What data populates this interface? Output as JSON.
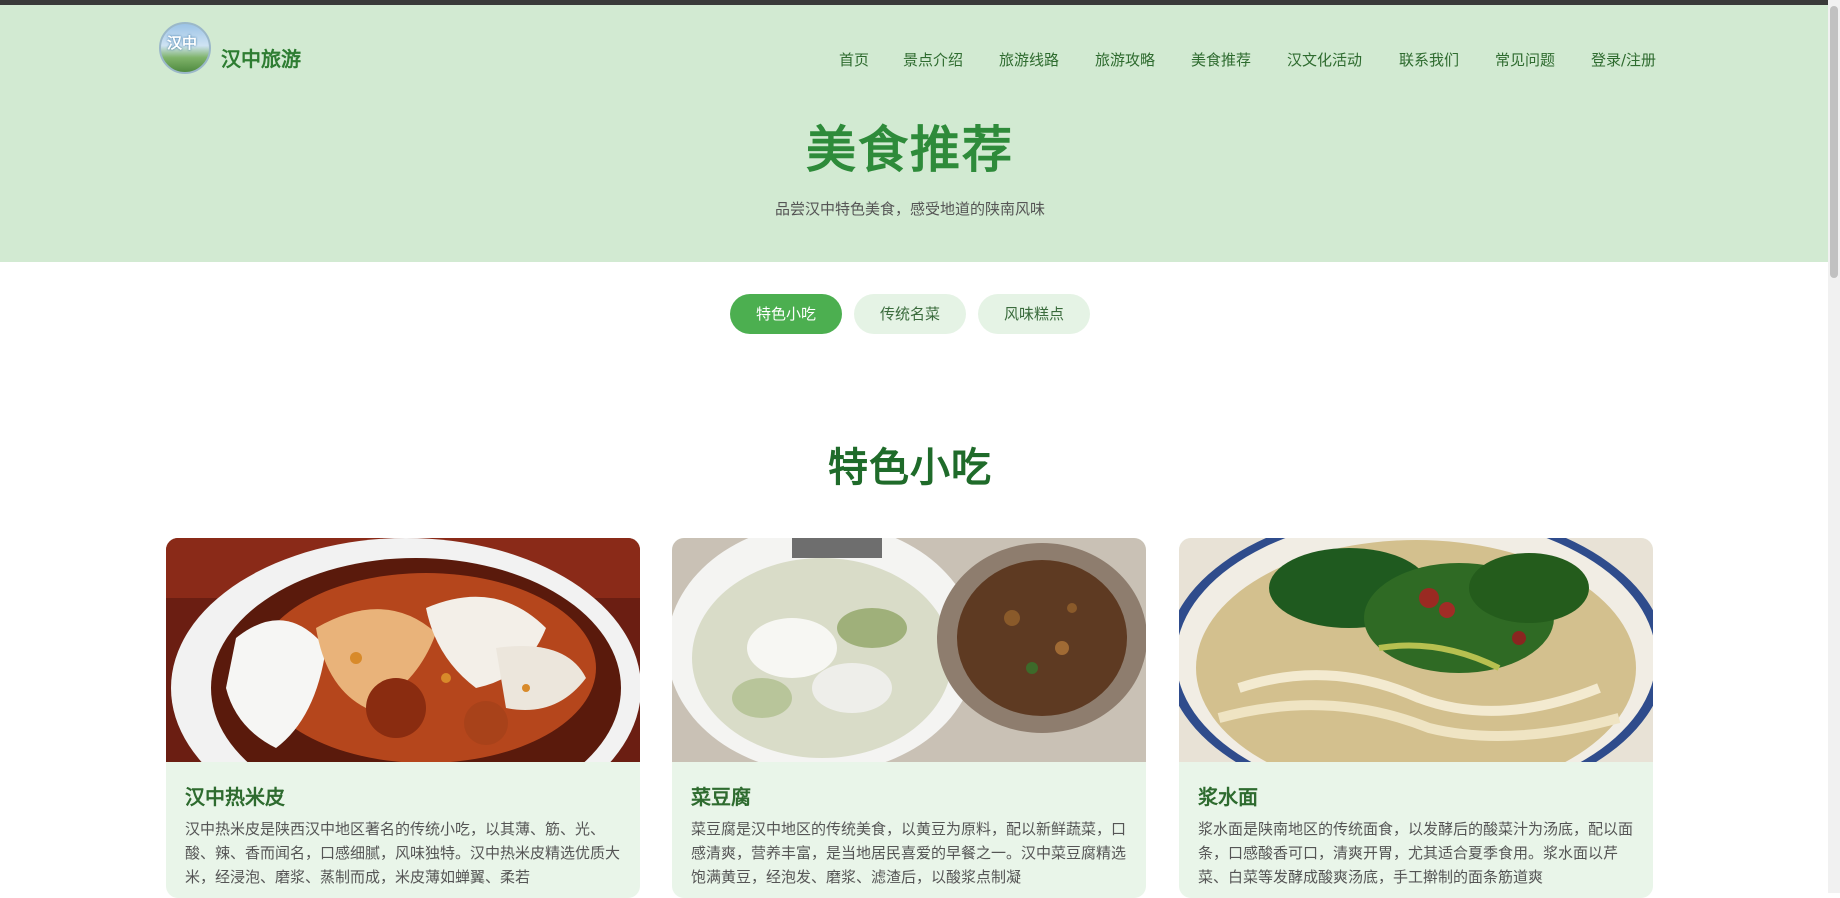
{
  "header": {
    "site_name": "汉中旅游",
    "logo_text": "汉中",
    "nav": [
      "首页",
      "景点介绍",
      "旅游线路",
      "旅游攻略",
      "美食推荐",
      "汉文化活动",
      "联系我们",
      "常见问题",
      "登录/注册"
    ]
  },
  "hero": {
    "title": "美食推荐",
    "subtitle": "品尝汉中特色美食，感受地道的陕南风味"
  },
  "tabs": [
    {
      "label": "特色小吃",
      "active": true
    },
    {
      "label": "传统名菜",
      "active": false
    },
    {
      "label": "风味糕点",
      "active": false
    }
  ],
  "section": {
    "title": "特色小吃"
  },
  "cards": [
    {
      "title": "汉中热米皮",
      "desc": "汉中热米皮是陕西汉中地区著名的传统小吃，以其薄、筋、光、酸、辣、香而闻名，口感细腻，风味独特。汉中热米皮精选优质大米，经浸泡、磨浆、蒸制而成，米皮薄如蝉翼、柔若"
    },
    {
      "title": "菜豆腐",
      "desc": "菜豆腐是汉中地区的传统美食，以黄豆为原料，配以新鲜蔬菜，口感清爽，营养丰富，是当地居民喜爱的早餐之一。汉中菜豆腐精选饱满黄豆，经泡发、磨浆、滤渣后，以酸浆点制凝"
    },
    {
      "title": "浆水面",
      "desc": "浆水面是陕南地区的传统面食，以发酵后的酸菜汁为汤底，配以面条，口感酸香可口，清爽开胃，尤其适合夏季食用。浆水面以芹菜、白菜等发酵成酸爽汤底，手工擀制的面条筋道爽"
    }
  ],
  "colors": {
    "header_bg": "#d2ead2",
    "brand_green": "#2e8b3a",
    "tab_active": "#4caf50",
    "card_bg": "#e9f5e9"
  }
}
